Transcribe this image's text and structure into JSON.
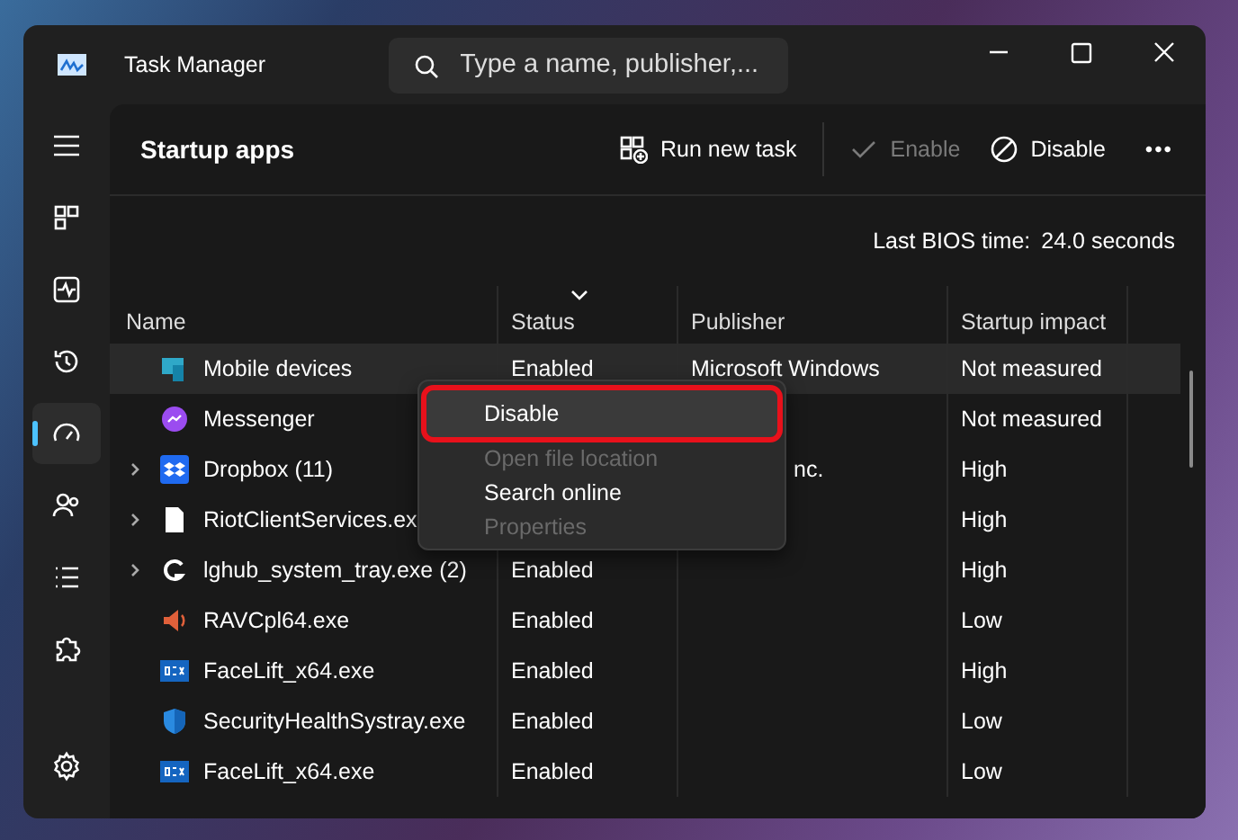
{
  "window": {
    "title": "Task Manager"
  },
  "search": {
    "placeholder": "Type a name, publisher,..."
  },
  "sidebar": {
    "items": [
      {
        "selected": false
      },
      {
        "selected": false
      },
      {
        "selected": false
      },
      {
        "selected": false
      },
      {
        "selected": true
      },
      {
        "selected": false
      },
      {
        "selected": false
      },
      {
        "selected": false
      },
      {
        "selected": false
      }
    ]
  },
  "page": {
    "title": "Startup apps"
  },
  "toolbar": [
    {
      "kind": "run",
      "label": "Run new task",
      "disabled": false
    },
    {
      "kind": "enable",
      "label": "Enable",
      "disabled": true
    },
    {
      "kind": "disable",
      "label": "Disable",
      "disabled": false
    },
    {
      "kind": "more",
      "label": "•••",
      "disabled": false
    }
  ],
  "bios": {
    "label": "Last BIOS time:",
    "value": "24.0 seconds"
  },
  "table": {
    "columns": [
      "Name",
      "Status",
      "Publisher",
      "Startup impact"
    ],
    "rows": [
      {
        "name": "Mobile devices",
        "status": "Enabled",
        "publisher": "Microsoft Windows",
        "impact": "Not measured",
        "selected": true
      },
      {
        "name": "Messenger",
        "impact": "Not measured",
        "selected": false
      },
      {
        "name": "Dropbox (11)",
        "publisher": "nc.",
        "publisher_partial": true,
        "impact": "High",
        "expanded": false,
        "selected": false
      },
      {
        "name": "RiotClientServices.ex",
        "impact": "High",
        "expanded": false,
        "selected": false
      },
      {
        "name": "lghub_system_tray.exe (2)",
        "status": "Enabled",
        "impact": "High",
        "expanded": false,
        "selected": false
      },
      {
        "name": "RAVCpl64.exe",
        "status": "Enabled",
        "impact": "Low",
        "selected": false
      },
      {
        "name": "FaceLift_x64.exe",
        "status": "Enabled",
        "impact": "High",
        "selected": false
      },
      {
        "name": "SecurityHealthSystray.exe",
        "status": "Enabled",
        "impact": "Low",
        "selected": false
      },
      {
        "name": "FaceLift_x64.exe",
        "status": "Enabled",
        "impact": "Low",
        "selected": false
      }
    ]
  },
  "context_menu": {
    "items": [
      {
        "label": "Disable",
        "disabled": false,
        "highlighted": true
      },
      {
        "label": "Open file location",
        "disabled": true,
        "highlighted": false
      },
      {
        "label": "Search online",
        "disabled": false,
        "highlighted": false
      },
      {
        "label": "Properties",
        "disabled": true,
        "highlighted": false
      }
    ]
  }
}
